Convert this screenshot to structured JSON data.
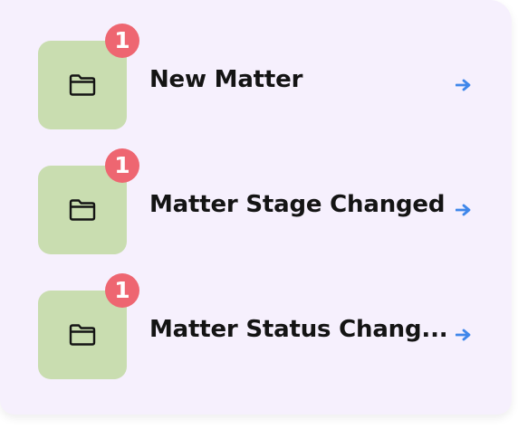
{
  "items": [
    {
      "title": "New Matter",
      "count": "1",
      "icon": "folder-icon",
      "arrow_icon": "arrow-right-icon"
    },
    {
      "title": "Matter Stage Changed",
      "count": "1",
      "icon": "folder-icon",
      "arrow_icon": "arrow-right-icon"
    },
    {
      "title": "Matter Status Chang...",
      "count": "1",
      "icon": "folder-icon",
      "arrow_icon": "arrow-right-icon"
    }
  ],
  "colors": {
    "card_background": "#f6f0fd",
    "tile_background": "#c9ddb0",
    "badge_background": "#ee6671",
    "arrow": "#3f87ea",
    "text": "#141414"
  }
}
